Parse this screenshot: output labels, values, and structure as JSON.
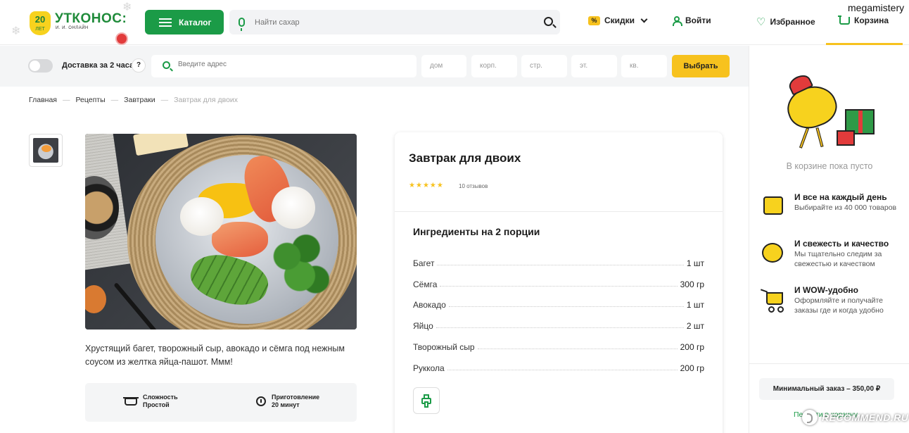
{
  "header": {
    "logo": {
      "badge_number": "20",
      "badge_sub": "ЛЕТ",
      "name": "УТКОНОС:",
      "tagline": "И. И. ОНЛАЙН"
    },
    "catalog_label": "Каталог",
    "search_placeholder": "Найти сахар",
    "discounts": {
      "badge": "%",
      "label": "Скидки"
    },
    "login_label": "Войти",
    "favorites_label": "Избранное",
    "cart_label": "Корзина",
    "username": "megamistery",
    "accent_color": "#1b9b47",
    "highlight_color": "#f7c21e"
  },
  "delivery": {
    "toggle_label": "Доставка за 2 часа",
    "help": "?",
    "address_placeholder": "Введите адрес",
    "fields": [
      "дом",
      "корп.",
      "стр.",
      "эт.",
      "кв."
    ],
    "choose_label": "Выбрать"
  },
  "breadcrumb": {
    "items": [
      "Главная",
      "Рецепты",
      "Завтраки"
    ],
    "current": "Завтрак для двоих",
    "separator": "—"
  },
  "recipe": {
    "description": "Хрустящий багет, творожный сыр, авокадо и сёмга под нежным соусом из желтка яйца-пашот. Ммм!",
    "difficulty": {
      "label": "Сложность",
      "value": "Простой"
    },
    "prep": {
      "label": "Приготовление",
      "value": "20 минут"
    },
    "title": "Завтрак для двоих",
    "rating": 5,
    "stars": "★",
    "reviews": "10 отзывов",
    "ingredients_title": "Ингредиенты на 2 порции",
    "ingredients": [
      {
        "name": "Багет",
        "qty": "1 шт"
      },
      {
        "name": "Сёмга",
        "qty": "300 гр"
      },
      {
        "name": "Авокадо",
        "qty": "1 шт"
      },
      {
        "name": "Яйцо",
        "qty": "2 шт"
      },
      {
        "name": "Творожный сыр",
        "qty": "200 гр"
      },
      {
        "name": "Руккола",
        "qty": "200 гр"
      }
    ]
  },
  "cart": {
    "empty_text": "В корзине пока пусто",
    "features": [
      {
        "title": "И все на каждый день",
        "text": "Выбирайте из 40 000 товаров"
      },
      {
        "title": "И свежесть и качество",
        "text": "Мы тщательно следим за свежестью и качеством"
      },
      {
        "title": "И WOW-удобно",
        "text": "Оформляйте и получайте заказы где и когда удобно"
      }
    ],
    "min_order": "Минимальный заказ – 350,00 ₽",
    "link": "Перейти в корзину"
  },
  "watermark": "RECOMMEND.RU"
}
